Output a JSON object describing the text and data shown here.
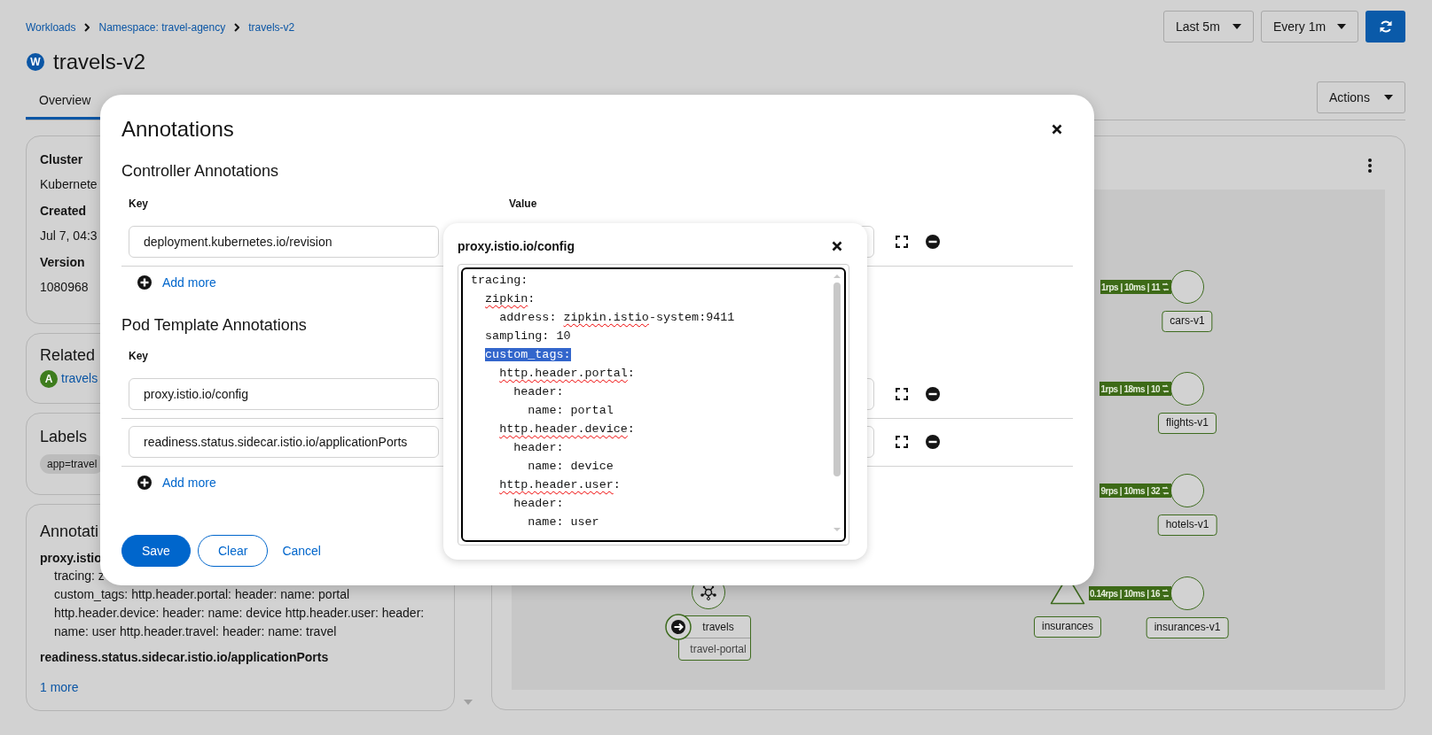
{
  "breadcrumbs": [
    {
      "label": "Workloads"
    },
    {
      "label": "Namespace: travel-agency"
    },
    {
      "label": "travels-v2"
    }
  ],
  "page_title": {
    "badge": "W",
    "title": "travels-v2"
  },
  "toolbar": {
    "duration": "Last 5m",
    "interval": "Every 1m"
  },
  "tabs": [
    {
      "label": "Overview",
      "selected": true
    }
  ],
  "actions_button": "Actions",
  "details_card": {
    "fields": [
      {
        "label": "Cluster",
        "value": "Kubernete"
      },
      {
        "label": "Created",
        "value": "Jul 7, 04:3"
      },
      {
        "label": "Version",
        "value": "1080968"
      }
    ]
  },
  "related_card": {
    "title": "Related",
    "items": [
      {
        "badge": "A",
        "name": "travels"
      }
    ]
  },
  "labels_card": {
    "title": "Labels",
    "labels": [
      "app=travel"
    ]
  },
  "annotations_card": {
    "title": "Annotati",
    "entries": [
      {
        "key": "proxy.istio",
        "lines": [
          "tracing: z",
          "custom_tags: http.header.portal: header: name: portal http.header.device: header: name: device http.header.user: header: name: user http.header.travel: header: name: travel"
        ]
      },
      {
        "key": "readiness.status.sidecar.istio.io/applicationPorts"
      }
    ],
    "more_link": "1 more"
  },
  "graph": {
    "nodes": [
      {
        "kind": "app",
        "label": "travels",
        "sublabel": "travel-portal"
      },
      {
        "kind": "service",
        "label": "insurances"
      },
      {
        "kind": "workload",
        "label": "cars-v1",
        "traffic": "1rps | 10ms | 11"
      },
      {
        "kind": "workload",
        "label": "flights-v1",
        "traffic": "1rps | 18ms | 10"
      },
      {
        "kind": "workload",
        "label": "hotels-v1",
        "traffic": "9rps | 10ms | 32"
      },
      {
        "kind": "workload",
        "label": "insurances-v1",
        "traffic": "0.14rps | 10ms | 16"
      }
    ]
  },
  "modal": {
    "title": "Annotations",
    "sections": [
      {
        "title": "Controller Annotations",
        "columns": [
          "Key",
          "Value"
        ],
        "rows": [
          {
            "key": "deployment.kubernetes.io/revision"
          }
        ],
        "add_label": "Add more"
      },
      {
        "title": "Pod Template Annotations",
        "columns": [
          "Key"
        ],
        "rows": [
          {
            "key": "proxy.istio.io/config"
          },
          {
            "key": "readiness.status.sidecar.istio.io/applicationPorts"
          }
        ],
        "add_label": "Add more"
      }
    ],
    "buttons": [
      {
        "label": "Save",
        "kind": "primary"
      },
      {
        "label": "Clear",
        "kind": "secondary"
      },
      {
        "label": "Cancel",
        "kind": "link"
      }
    ]
  },
  "popover": {
    "title": "proxy.istio.io/config",
    "lines": [
      {
        "parts": [
          {
            "text": "tracing:",
            "misspelled": false
          }
        ],
        "selected": false,
        "children": [
          {
            "parts": [
              {
                "text": "zipkin",
                "misspelled": true
              },
              {
                "text": ":",
                "misspelled": false
              }
            ],
            "selected": false,
            "children": [
              {
                "parts": [
                  {
                    "text": "address: ",
                    "misspelled": false
                  },
                  {
                    "text": "zipkin.istio",
                    "misspelled": true
                  },
                  {
                    "text": "-system:9411",
                    "misspelled": false
                  }
                ],
                "selected": false
              }
            ]
          },
          {
            "parts": [
              {
                "text": "sampling: 10",
                "misspelled": false
              }
            ],
            "selected": false
          },
          {
            "parts": [
              {
                "text": "custom_tags:",
                "misspelled": false
              }
            ],
            "selected": true,
            "children": [
              {
                "parts": [
                  {
                    "text": "http.header.portal",
                    "misspelled": true
                  },
                  {
                    "text": ":",
                    "misspelled": false
                  }
                ],
                "selected": false,
                "children": [
                  {
                    "parts": [
                      {
                        "text": "header:",
                        "misspelled": false
                      }
                    ],
                    "selected": false,
                    "children": [
                      {
                        "parts": [
                          {
                            "text": "name: portal",
                            "misspelled": false
                          }
                        ],
                        "selected": false
                      }
                    ]
                  }
                ]
              },
              {
                "parts": [
                  {
                    "text": "http.header.device",
                    "misspelled": true
                  },
                  {
                    "text": ":",
                    "misspelled": false
                  }
                ],
                "selected": false,
                "children": [
                  {
                    "parts": [
                      {
                        "text": "header:",
                        "misspelled": false
                      }
                    ],
                    "selected": false,
                    "children": [
                      {
                        "parts": [
                          {
                            "text": "name: device",
                            "misspelled": false
                          }
                        ],
                        "selected": false
                      }
                    ]
                  }
                ]
              },
              {
                "parts": [
                  {
                    "text": "http.header.user",
                    "misspelled": true
                  },
                  {
                    "text": ":",
                    "misspelled": false
                  }
                ],
                "selected": false,
                "children": [
                  {
                    "parts": [
                      {
                        "text": "header:",
                        "misspelled": false
                      }
                    ],
                    "selected": false,
                    "children": [
                      {
                        "parts": [
                          {
                            "text": "name: user",
                            "misspelled": false
                          }
                        ],
                        "selected": false
                      }
                    ]
                  }
                ]
              }
            ]
          }
        ]
      }
    ]
  }
}
